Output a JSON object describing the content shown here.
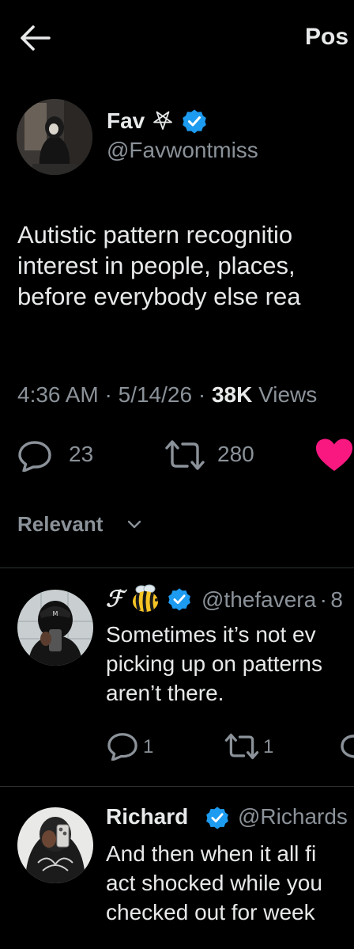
{
  "header": {
    "title": "Pos"
  },
  "post": {
    "author_name": "Fav",
    "author_handle": "@Favwontmiss",
    "text_lines": [
      "Autistic pattern recognitio",
      "interest in people, places,",
      "before everybody else rea"
    ],
    "time": "4:36 AM",
    "sep1": "·",
    "date": "5/14/26",
    "sep2": "·",
    "views_count": "38K",
    "views_label": "Views",
    "replies": "23",
    "reposts": "280"
  },
  "sort": {
    "label": "Relevant"
  },
  "replies": [
    {
      "name": "ℱ",
      "handle": "@thefavera",
      "sep": "·",
      "time_partial": "8",
      "text_lines": [
        "Sometimes it’s not ev",
        "picking up on patterns",
        "aren’t there."
      ],
      "replies": "1",
      "reposts": "1"
    },
    {
      "name": "Richard",
      "handle": "@Richards",
      "text_lines": [
        "And then when it all fi",
        "act shocked while you",
        "checked out for week"
      ]
    }
  ],
  "colors": {
    "background": "#000000",
    "text": "#e7e9ea",
    "muted": "#8b9299",
    "verified": "#1d9bf0",
    "like": "#f91880",
    "divider": "#2f3336"
  },
  "icons": [
    "back-arrow-icon",
    "pentagram-icon",
    "verified-icon",
    "reply-icon",
    "repost-icon",
    "heart-icon",
    "chevron-down-icon",
    "bee-emoji-icon"
  ]
}
